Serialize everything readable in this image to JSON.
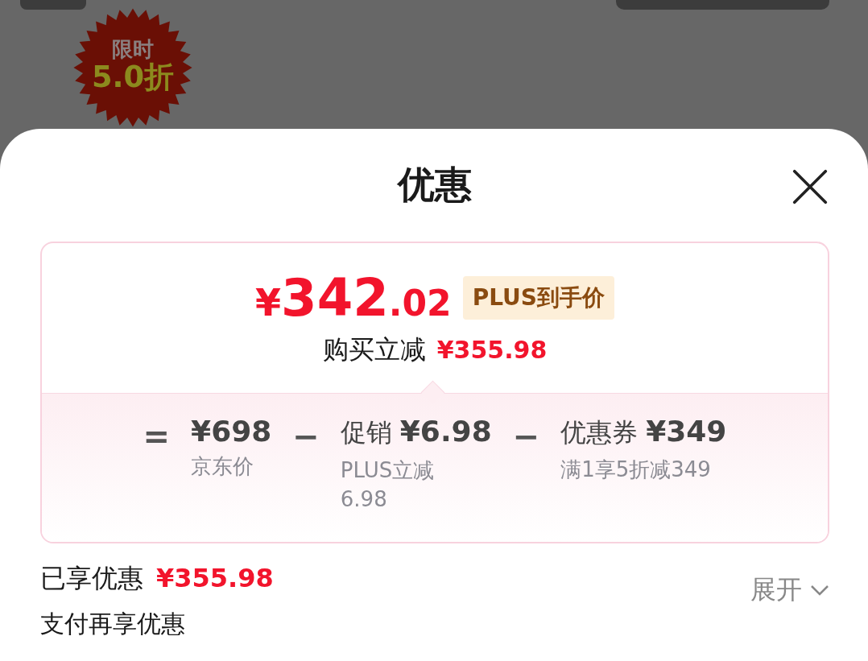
{
  "backdrop": {
    "badge": {
      "line_1": "限时",
      "line_2": "5.0折"
    }
  },
  "sheet": {
    "title": "优惠",
    "price": {
      "currency": "¥",
      "integer": "342",
      "decimal": ".02"
    },
    "price_tag": "PLUS到手价",
    "saving_label": "购买立减",
    "saving_amount": "¥355.98",
    "breakdown": [
      {
        "operator": "=",
        "amount": "¥698",
        "note": "京东价"
      },
      {
        "operator": "−",
        "label": "促销",
        "amount": "¥6.98",
        "note": "PLUS立减 6.98"
      },
      {
        "operator": "−",
        "label": "优惠券",
        "amount": "¥349",
        "note": "满1享5折减349"
      }
    ],
    "enjoyed_label": "已享优惠",
    "enjoyed_amount": "¥355.98",
    "expand": {
      "label": "展开",
      "expanded": false
    },
    "next_section": "支付再享优惠"
  }
}
